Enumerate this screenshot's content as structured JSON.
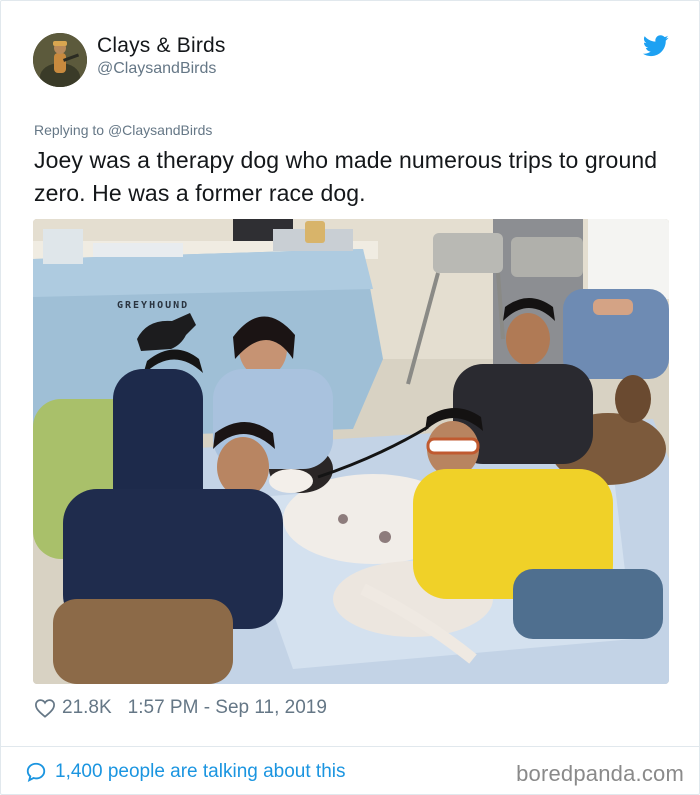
{
  "tweet": {
    "display_name": "Clays & Birds",
    "handle": "@ClaysandBirds",
    "reply_prefix": "Replying to",
    "reply_handle": "@ClaysandBirds",
    "text": "Joey was a therapy dog who made numerous trips to ground zero. He was a former race dog.",
    "likes": "21.8K",
    "timestamp": "1:57 PM - Sep 11, 2019",
    "talking": "1,400 people are talking about this"
  },
  "photo": {
    "banner_text": "GREYHOUND"
  },
  "footer": {
    "watermark": "boredpanda.com"
  },
  "colors": {
    "twitter_blue": "#1da1f2",
    "link_blue": "#1b95e0",
    "muted": "#657786"
  },
  "icons": {
    "brand": "twitter-bird-icon",
    "like": "heart-outline-icon",
    "conversation": "speech-bubble-icon"
  }
}
